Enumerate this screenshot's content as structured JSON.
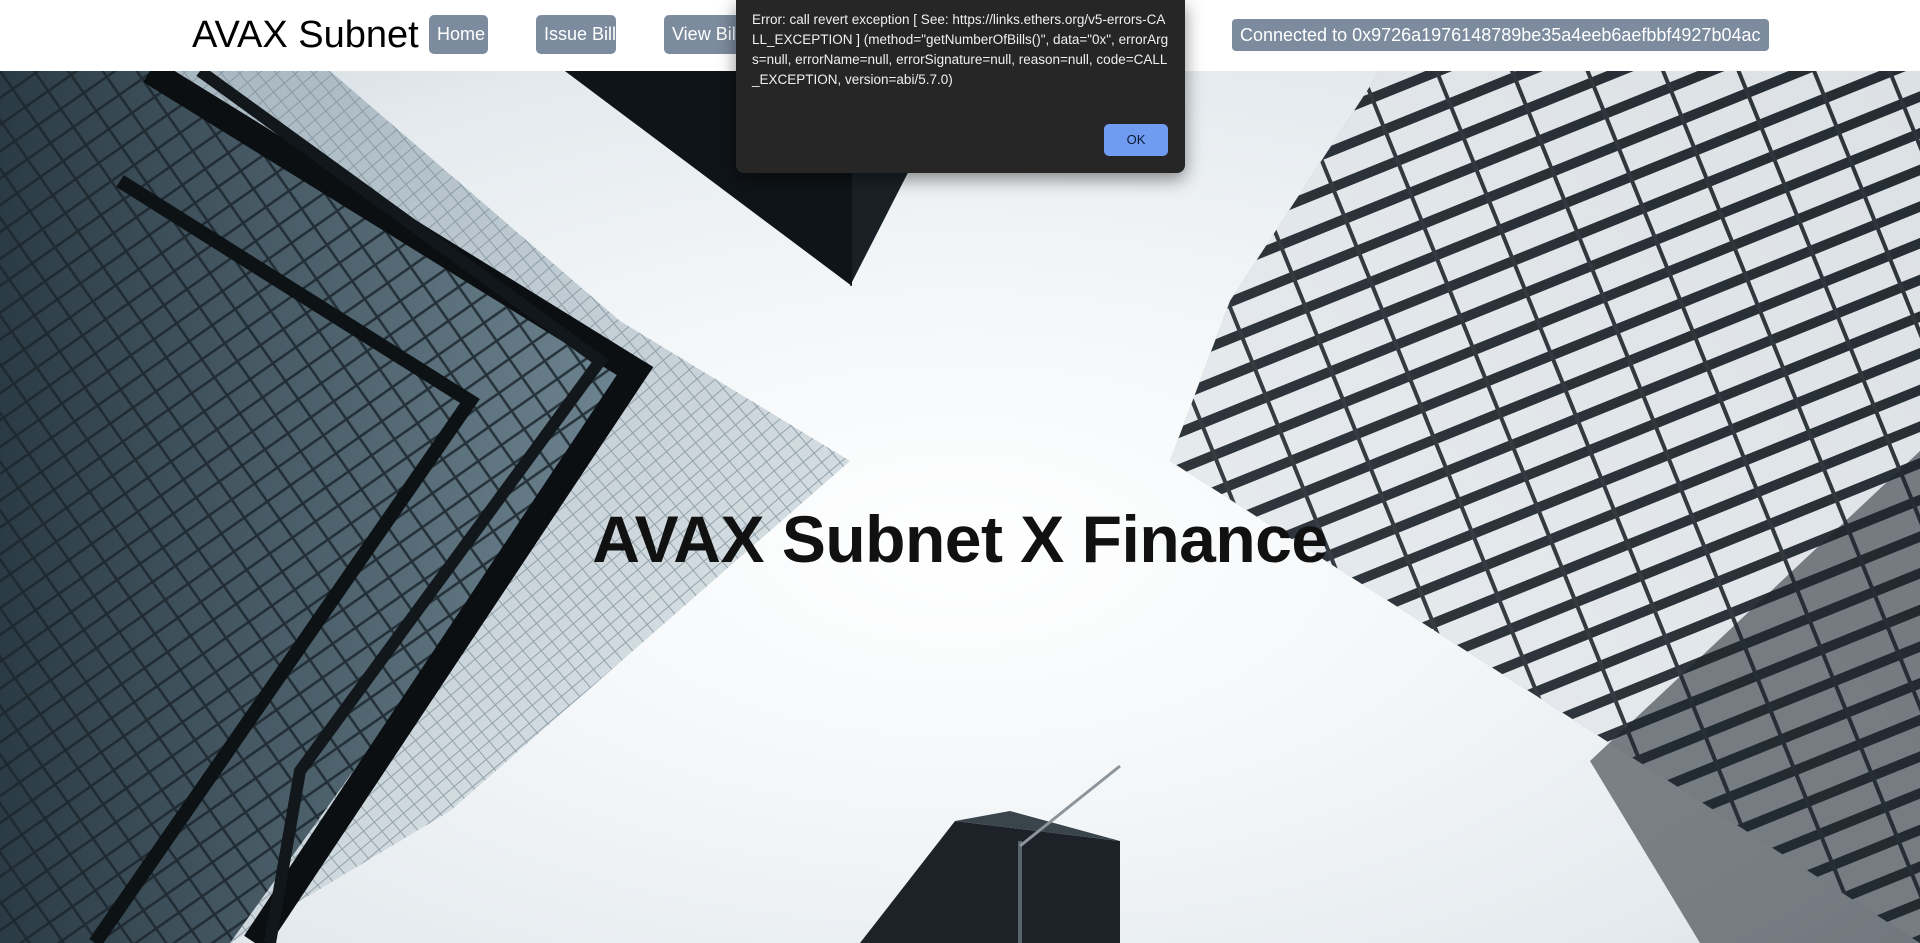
{
  "header": {
    "brand": "AVAX Subnet",
    "nav": {
      "home": "Home",
      "issue_bill": "Issue Bill",
      "view_bills": "View Bills"
    },
    "wallet_status": "Connected to 0x9726a1976148789be35a4eeb6aefbbf4927b04ac"
  },
  "hero": {
    "title": "AVAX Subnet X Finance"
  },
  "alert": {
    "message": "Error: call revert exception [ See: https://links.ethers.org/v5-errors-CALL_EXCEPTION ] (method=\"getNumberOfBills()\", data=\"0x\", errorArgs=null, errorName=null, errorSignature=null, reason=null, code=CALL_EXCEPTION, version=abi/5.7.0)",
    "ok_label": "OK"
  },
  "colors": {
    "nav_button": "#7c8b9e",
    "dialog_bg": "#262626",
    "ok_button": "#6f9cf0"
  }
}
